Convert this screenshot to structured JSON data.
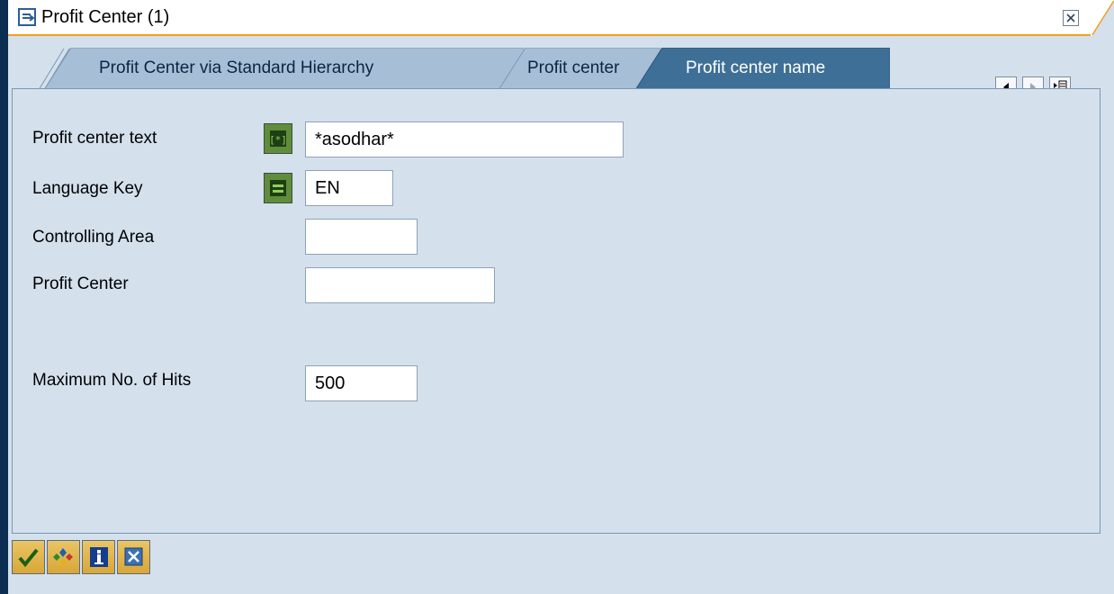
{
  "window": {
    "title": "Profit Center (1)"
  },
  "tabs": [
    {
      "label": "Profit Center via Standard Hierarchy",
      "active": false
    },
    {
      "label": "Profit center",
      "active": false
    },
    {
      "label": "Profit center name",
      "active": true
    }
  ],
  "form": {
    "profit_center_text": {
      "label": "Profit center text",
      "value": "*asodhar*"
    },
    "language_key": {
      "label": "Language Key",
      "value": "EN"
    },
    "controlling_area": {
      "label": "Controlling Area",
      "value": ""
    },
    "profit_center": {
      "label": "Profit Center",
      "value": ""
    },
    "max_hits": {
      "label": "Maximum No. of Hits",
      "value": "500"
    }
  },
  "toolbar": {
    "buttons": [
      "check-icon",
      "multi-select-icon",
      "info-icon",
      "cancel-icon"
    ]
  },
  "colors": {
    "window_bg": "#d4e0ec",
    "active_tab": "#3e6f97",
    "inactive_tab": "#a7bfd6",
    "title_accent": "#f0a020",
    "option_button": "#5f8d3b"
  }
}
